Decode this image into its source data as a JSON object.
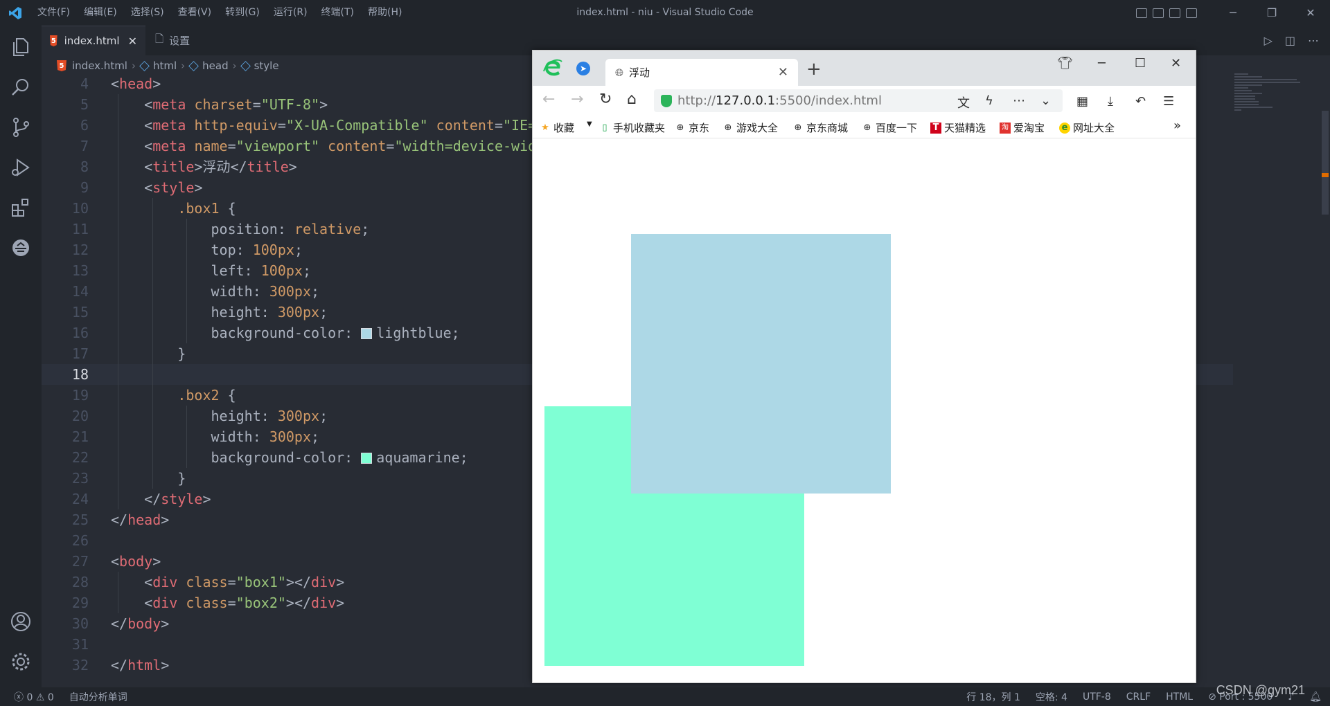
{
  "window": {
    "title": "index.html - niu - Visual Studio Code",
    "menu": [
      "文件(F)",
      "编辑(E)",
      "选择(S)",
      "查看(V)",
      "转到(G)",
      "运行(R)",
      "终端(T)",
      "帮助(H)"
    ]
  },
  "tabs": [
    {
      "label": "index.html",
      "active": true,
      "icon": "html5-icon"
    },
    {
      "label": "设置",
      "active": false,
      "icon": "file-icon"
    }
  ],
  "breadcrumb": [
    "index.html",
    "html",
    "head",
    "style"
  ],
  "code": {
    "current_line": 18,
    "line_numbers": [
      "4",
      "5",
      "6",
      "7",
      "8",
      "9",
      "10",
      "11",
      "12",
      "13",
      "14",
      "15",
      "16",
      "17",
      "18",
      "19",
      "20",
      "21",
      "22",
      "23",
      "24",
      "25",
      "26",
      "27",
      "28",
      "29",
      "30",
      "31",
      "32"
    ]
  },
  "colors": {
    "box1": "#add8e6",
    "box2": "#7fffd4",
    "editor_bg": "#282c34"
  },
  "statusbar": {
    "errors": "0",
    "warnings": "0",
    "spell": "自动分析单词",
    "position": "行 18，列 1",
    "spaces": "空格: 4",
    "encoding": "UTF-8",
    "eol": "CRLF",
    "language": "HTML",
    "port": "Port : 5500"
  },
  "watermark": "CSDN @gym21",
  "browser": {
    "tab_title": "浮动",
    "url_prefix": "http://",
    "url_host": "127.0.0.1",
    "url_rest": ":5500/index.html",
    "bookmarks": [
      "收藏",
      "手机收藏夹",
      "京东",
      "游戏大全",
      "京东商城",
      "百度一下",
      "天猫精选",
      "爱淘宝",
      "网址大全"
    ]
  }
}
